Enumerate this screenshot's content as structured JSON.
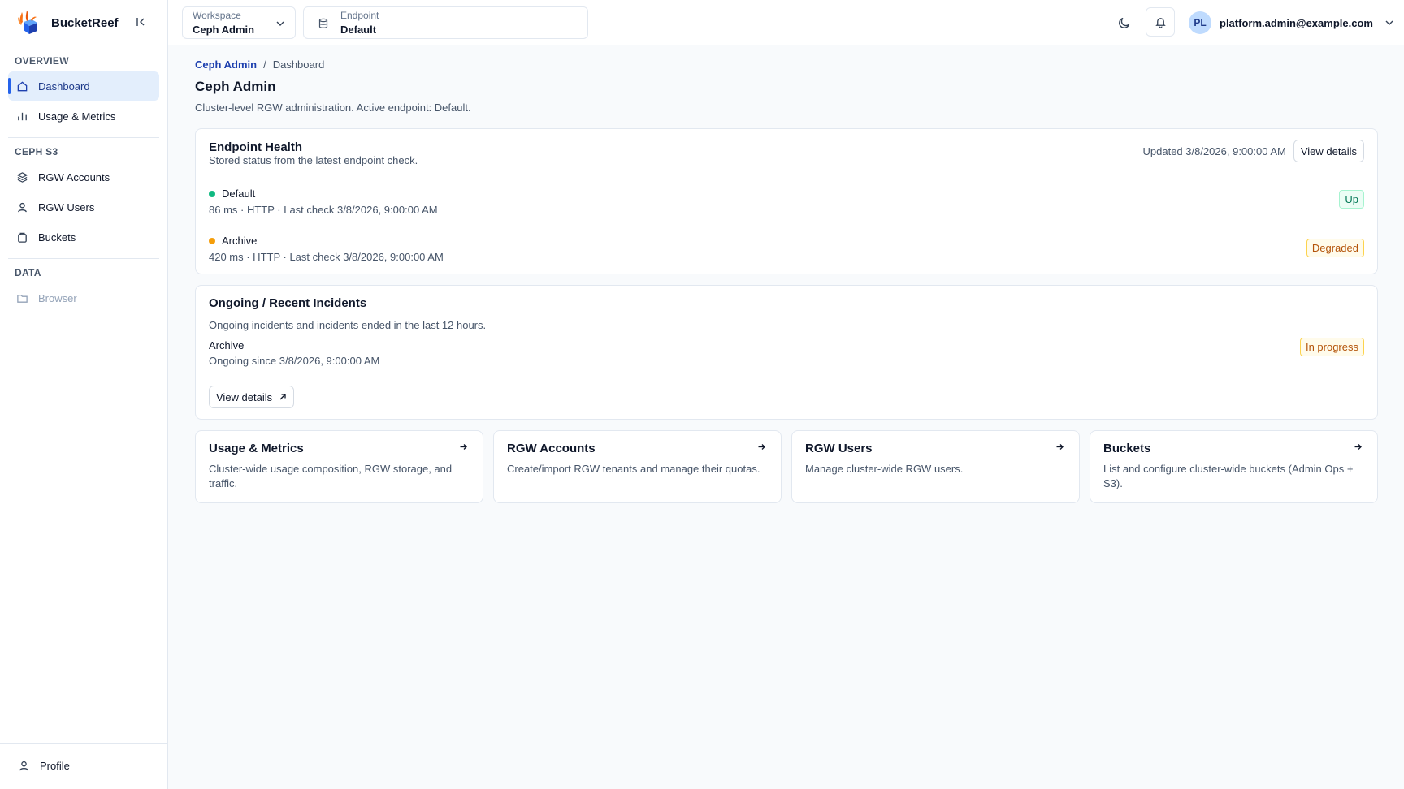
{
  "brand": {
    "name": "BucketReef"
  },
  "sidebar": {
    "sections": [
      {
        "heading": "OVERVIEW",
        "items": [
          {
            "label": "Dashboard",
            "icon": "home-icon"
          },
          {
            "label": "Usage & Metrics",
            "icon": "bar-chart-icon"
          }
        ]
      },
      {
        "heading": "CEPH S3",
        "items": [
          {
            "label": "RGW Accounts",
            "icon": "layers-icon"
          },
          {
            "label": "RGW Users",
            "icon": "user-icon"
          },
          {
            "label": "Buckets",
            "icon": "bucket-icon"
          }
        ]
      },
      {
        "heading": "DATA",
        "items": [
          {
            "label": "Browser",
            "icon": "folder-icon"
          }
        ]
      }
    ],
    "footer": {
      "label": "Profile",
      "icon": "user-icon"
    }
  },
  "topbar": {
    "workspace": {
      "label": "Workspace",
      "value": "Ceph Admin"
    },
    "endpoint": {
      "label": "Endpoint",
      "value": "Default"
    },
    "user": {
      "initials": "PL",
      "email": "platform.admin@example.com"
    }
  },
  "breadcrumb": {
    "root": "Ceph Admin",
    "separator": "/",
    "current": "Dashboard"
  },
  "page": {
    "title": "Ceph Admin",
    "subtitle": "Cluster-level RGW administration. Active endpoint: Default."
  },
  "health": {
    "title": "Endpoint Health",
    "description": "Stored status from the latest endpoint check.",
    "updated": "Updated 3/8/2026, 9:00:00 AM",
    "button": "View details",
    "endpoints": [
      {
        "name": "Default",
        "detail": "86 ms · HTTP · Last check 3/8/2026, 9:00:00 AM",
        "status": "Up",
        "dot_color": "#10b981"
      },
      {
        "name": "Archive",
        "detail": "420 ms · HTTP · Last check 3/8/2026, 9:00:00 AM",
        "status": "Degraded",
        "dot_color": "#f59e0b"
      }
    ]
  },
  "incidents": {
    "title": "Ongoing / Recent Incidents",
    "description": "Ongoing incidents and incidents ended in the last 12 hours.",
    "items": [
      {
        "name": "Archive",
        "since": "Ongoing since 3/8/2026, 9:00:00 AM",
        "status": "In progress"
      }
    ],
    "button": "View details"
  },
  "quick_links": [
    {
      "title": "Usage & Metrics",
      "description": "Cluster-wide usage composition, RGW storage, and traffic."
    },
    {
      "title": "RGW Accounts",
      "description": "Create/import RGW tenants and manage their quotas."
    },
    {
      "title": "RGW Users",
      "description": "Manage cluster-wide RGW users."
    },
    {
      "title": "Buckets",
      "description": "List and configure cluster-wide buckets (Admin Ops + S3)."
    }
  ],
  "colors": {
    "accent": "#2563eb",
    "active_bg": "#e3eefc",
    "success": "#10b981",
    "warning": "#f59e0b"
  }
}
